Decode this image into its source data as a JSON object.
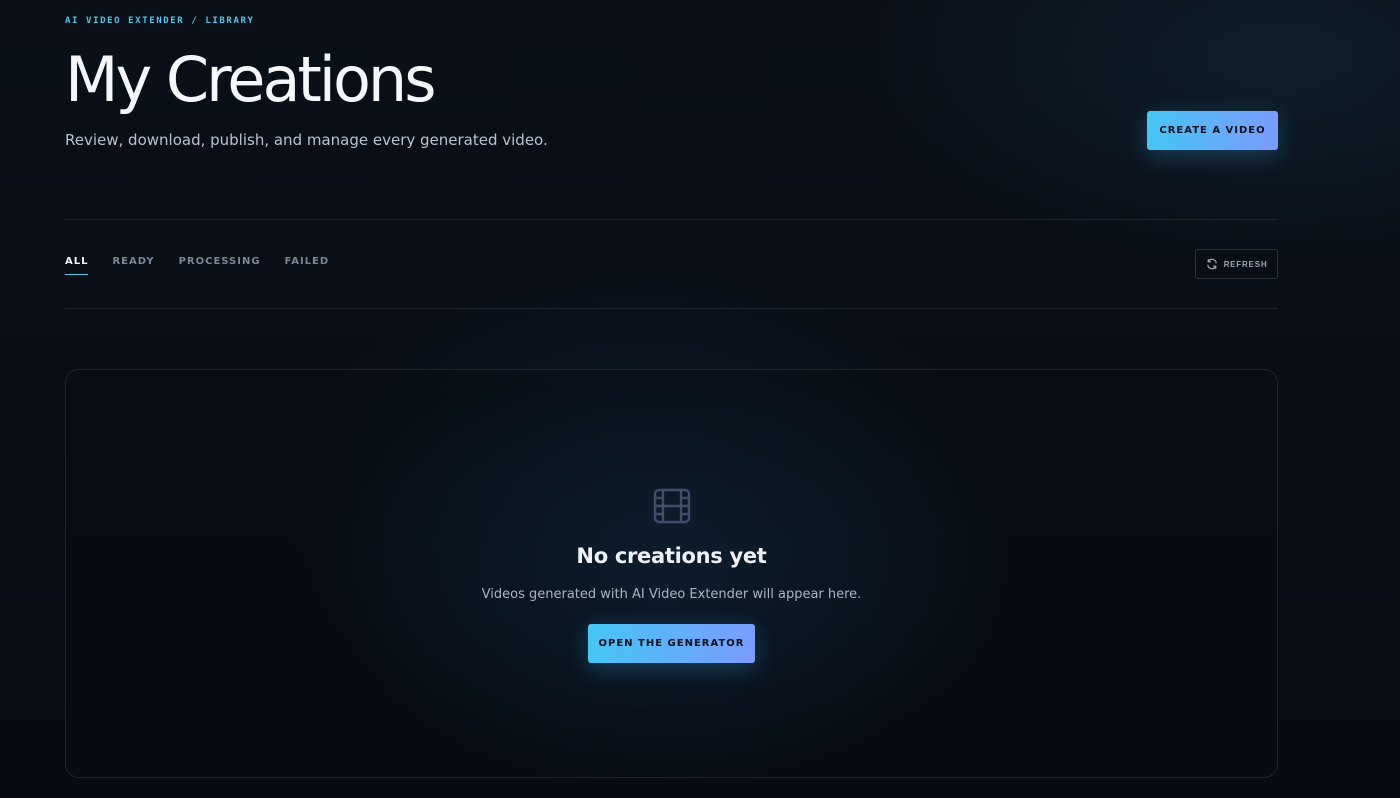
{
  "header": {
    "breadcrumb": "AI VIDEO EXTENDER / LIBRARY",
    "title": "My Creations",
    "subtitle": "Review, download, publish, and manage every generated video.",
    "create_label": "CREATE A VIDEO"
  },
  "tabs": [
    {
      "label": "ALL",
      "active": true
    },
    {
      "label": "READY",
      "active": false
    },
    {
      "label": "PROCESSING",
      "active": false
    },
    {
      "label": "FAILED",
      "active": false
    }
  ],
  "toolbar": {
    "refresh_label": "REFRESH",
    "refresh_icon": "refresh-icon"
  },
  "empty_state": {
    "icon": "film-icon",
    "title": "No creations yet",
    "text": "Videos generated with AI Video Extender will appear here.",
    "button_label": "OPEN THE GENERATOR"
  },
  "colors": {
    "accent": "#4fc8ec",
    "button_gradient_start": "#46c6f4",
    "button_gradient_end": "#7a9bff",
    "background": "#0b1018"
  }
}
